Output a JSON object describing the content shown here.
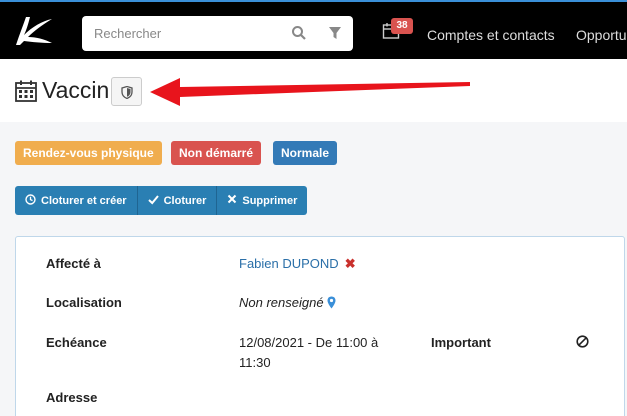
{
  "header": {
    "search_placeholder": "Rechercher",
    "notification_count": "38",
    "nav": [
      "Comptes et contacts",
      "Opportu"
    ]
  },
  "page": {
    "title": "Vaccin"
  },
  "tags": [
    "Rendez-vous physique",
    "Non démarré",
    "Normale"
  ],
  "actions": [
    "Cloturer et créer",
    "Cloturer",
    "Supprimer"
  ],
  "details": {
    "assigned_label": "Affecté à",
    "assigned_value": "Fabien DUPOND",
    "location_label": "Localisation",
    "location_value": "Non renseigné",
    "due_label": "Echéance",
    "due_value_line1": "12/08/2021 - De 11:00 à",
    "due_value_line2": "11:30",
    "important_label": "Important",
    "address_label": "Adresse"
  },
  "colors": {
    "accent": "#337ab7",
    "warning": "#f0ad4e",
    "danger": "#d9534f",
    "arrow": "#e8141c"
  },
  "icons": [
    "logo-icon",
    "search-icon",
    "filter-icon",
    "calendar-icon",
    "shield-icon",
    "clock-icon",
    "check-icon",
    "close-icon",
    "map-marker-icon",
    "ban-icon"
  ]
}
